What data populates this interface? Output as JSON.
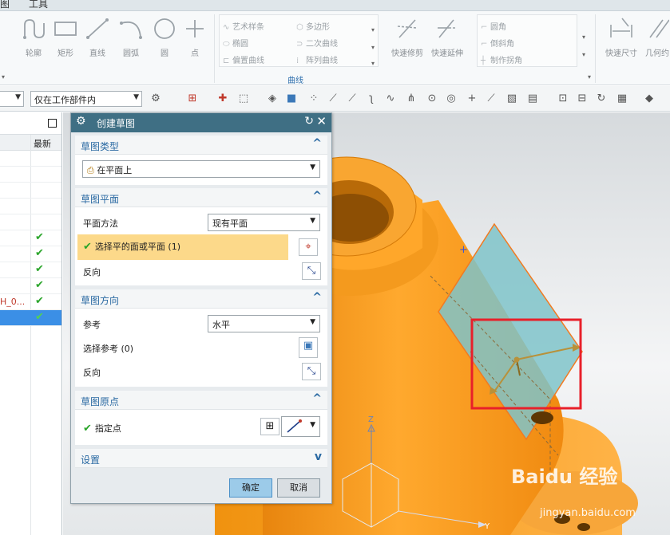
{
  "menu": {
    "item1": "图",
    "item2": "工具"
  },
  "ribbon": {
    "tools": [
      {
        "label": "轮廓",
        "icon": "profile-icon"
      },
      {
        "label": "矩形",
        "icon": "rectangle-icon"
      },
      {
        "label": "直线",
        "icon": "line-icon"
      },
      {
        "label": "圆弧",
        "icon": "arc-icon"
      },
      {
        "label": "圆",
        "icon": "circle-icon"
      },
      {
        "label": "点",
        "icon": "point-icon"
      }
    ],
    "curve_group": {
      "items": [
        "艺术样条",
        "多边形",
        "椭圆",
        "二次曲线",
        "偏置曲线",
        "阵列曲线"
      ],
      "label": "曲线"
    },
    "trim_tools": [
      {
        "label": "快速修剪",
        "icon": "quick-trim-icon"
      },
      {
        "label": "快速延伸",
        "icon": "quick-extend-icon"
      }
    ],
    "corner_group": {
      "items": [
        "圆角",
        "倒斜角",
        "制作拐角"
      ]
    },
    "dim_tools": [
      {
        "label": "快速尺寸",
        "icon": "rapid-dimension-icon"
      },
      {
        "label": "几何约",
        "icon": "geometric-constraint-icon"
      }
    ]
  },
  "toolbar2": {
    "filter_value": "仅在工作部件内"
  },
  "navigator": {
    "column_latest": "最新",
    "rows": [
      {
        "name": "",
        "check": false
      },
      {
        "name": "",
        "check": false
      },
      {
        "name": "",
        "check": false
      },
      {
        "name": "",
        "check": false
      },
      {
        "name": "",
        "check": false
      },
      {
        "name": "",
        "check": true
      },
      {
        "name": "",
        "check": true
      },
      {
        "name": "",
        "check": true
      },
      {
        "name": "",
        "check": true
      },
      {
        "name": "H_0...",
        "check": true
      },
      {
        "name": "",
        "check": true,
        "selected": true
      }
    ],
    "check_glyph": "✔"
  },
  "dialog": {
    "title": "创建草图",
    "sections": {
      "sketch_type": {
        "title": "草图类型",
        "value": "在平面上"
      },
      "sketch_plane": {
        "title": "草图平面",
        "plane_method_label": "平面方法",
        "plane_method_value": "现有平面",
        "select_label": "选择平的面或平面 (1)",
        "reverse_label": "反向"
      },
      "sketch_orientation": {
        "title": "草图方向",
        "reference_label": "参考",
        "reference_value": "水平",
        "select_ref_label": "选择参考 (0)",
        "reverse_label": "反向"
      },
      "sketch_origin": {
        "title": "草图原点",
        "point_label": "指定点"
      },
      "settings": {
        "title": "设置"
      }
    },
    "ok_label": "确定",
    "cancel_label": "取消"
  },
  "viewport": {
    "axis_z": "Z",
    "axis_y": "Y",
    "watermark": "Baidu 经验",
    "watermark_url": "jingyan.baidu.com"
  },
  "colors": {
    "part_orange": "#f59a1c",
    "plane_cyan": "#7fc3c9",
    "highlight_red": "#e8202a",
    "dialog_title": "#3f6f84",
    "selection_yellow": "#fcd98a"
  }
}
